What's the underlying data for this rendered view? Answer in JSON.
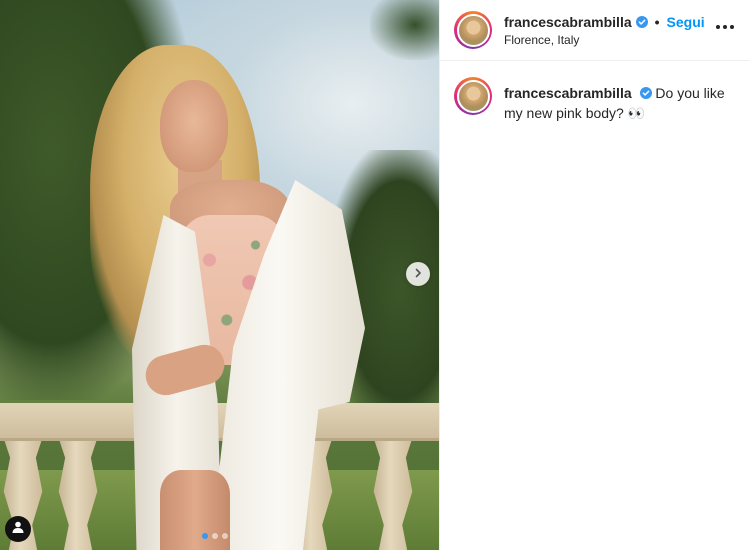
{
  "post": {
    "username": "francescabrambilla",
    "separator": "•",
    "follow_label": "Segui",
    "location": "Florence, Italy",
    "caption": "Do you like my new pink body? 👀",
    "carousel": {
      "slide_count": 3,
      "active_index": 0
    }
  },
  "icons": {
    "verified": "verified-badge-icon",
    "more": "more-options-icon",
    "next": "chevron-right-icon",
    "user_tags": "user-tag-icon"
  },
  "colors": {
    "accent": "#0095f6",
    "verified": "#3897f0",
    "text": "#262626",
    "divider": "#efefef"
  }
}
